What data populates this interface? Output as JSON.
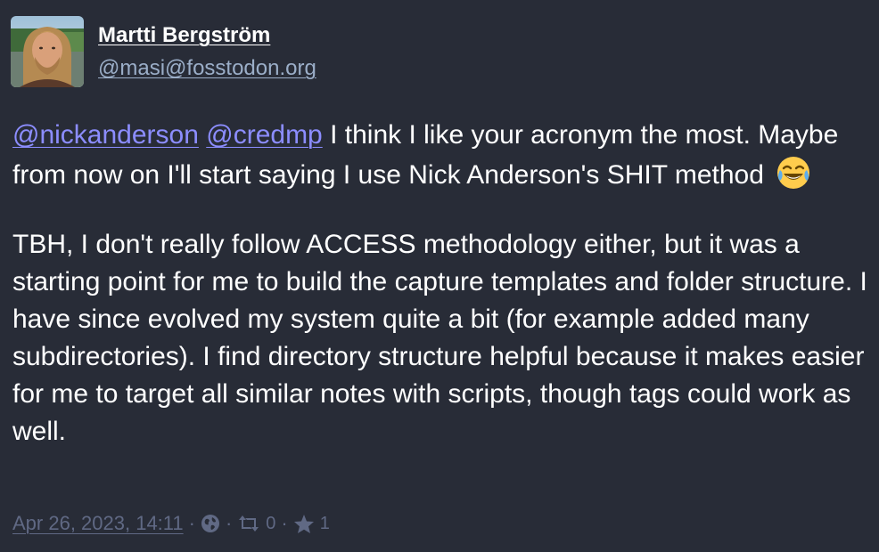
{
  "author": {
    "display_name": "Martti Bergström",
    "account": "@masi@fosstodon.org",
    "avatar_icon": "avatar-photo"
  },
  "content": {
    "mention1": "@nickanderson",
    "mention2": "@credmp",
    "p1_text_a": " I think I like your acronym the most. Maybe from now on I'll start saying I use Nick Anderson's SHIT method ",
    "emoji": "joy-emoji",
    "p2_text": "TBH, I don't really follow ACCESS methodology either, but it was a starting point for me to build the capture templates and folder structure. I have since evolved my system quite a bit (for example added many subdirectories). I find directory structure helpful because it makes easier for me to target all similar notes with scripts, though tags could work as well."
  },
  "meta": {
    "timestamp": "Apr 26, 2023, 14:11",
    "separator": "·",
    "visibility_icon": "globe-icon",
    "boost_icon": "retweet-icon",
    "boost_count": "0",
    "favourite_icon": "star-icon",
    "favourite_count": "1"
  },
  "colors": {
    "background": "#282c37",
    "text": "#ffffff",
    "mention": "#8c8dff",
    "secondary": "#9baec8",
    "muted": "#606984"
  }
}
